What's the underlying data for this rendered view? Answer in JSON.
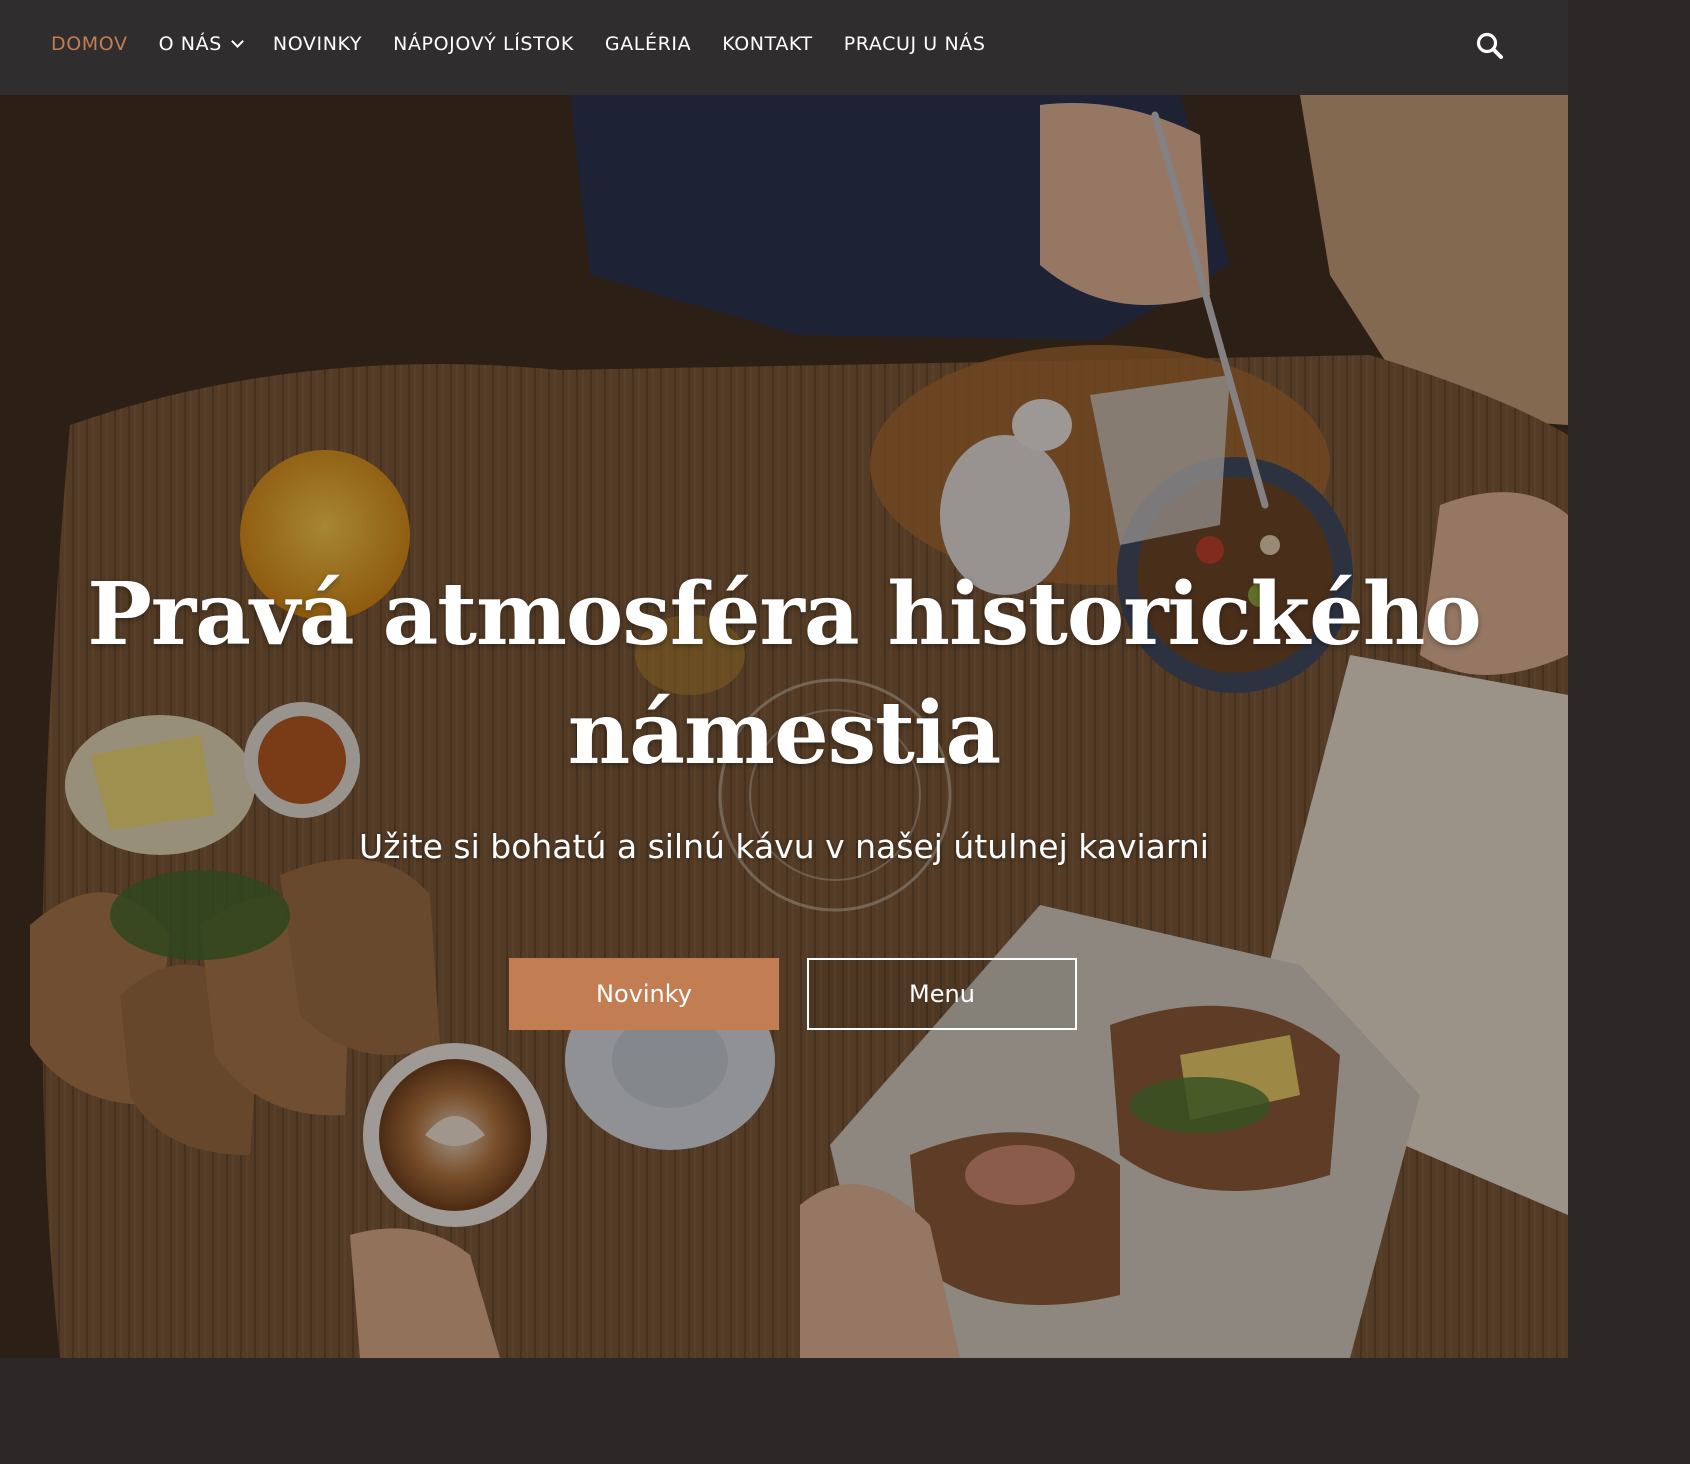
{
  "nav": {
    "items": [
      {
        "label": "DOMOV",
        "active": true
      },
      {
        "label": "O NÁS",
        "has_dropdown": true
      },
      {
        "label": "NOVINKY"
      },
      {
        "label": "NÁPOJOVÝ LÍSTOK"
      },
      {
        "label": "GALÉRIA"
      },
      {
        "label": "KONTAKT"
      },
      {
        "label": "PRACUJ U NÁS"
      }
    ],
    "search_icon": "search-icon"
  },
  "hero": {
    "title": "Pravá atmosféra historického námestia",
    "subtitle": "Užite si bohatú a silnú kávu v našej útulnej kaviarni",
    "primary_button": "Novinky",
    "secondary_button": "Menu"
  },
  "colors": {
    "accent": "#c27d52",
    "navbar_bg": "#2f2d2d",
    "text": "#ffffff"
  }
}
